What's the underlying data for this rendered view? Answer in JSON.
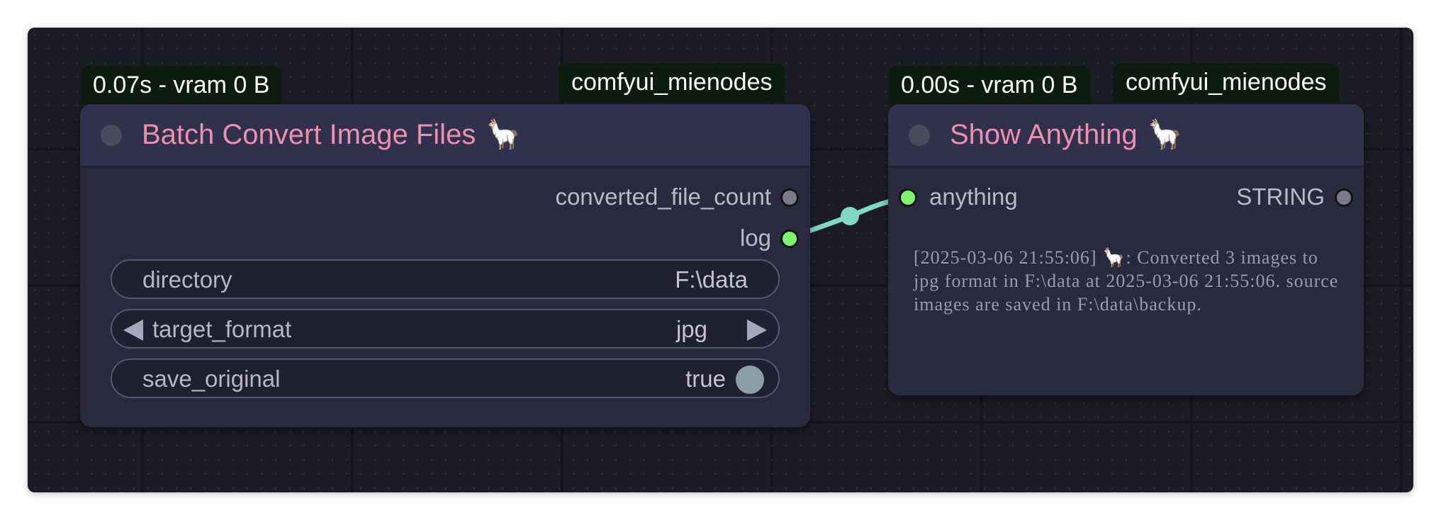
{
  "nodes": {
    "batch_convert": {
      "timing_badge": "0.07s - vram 0 B",
      "source_badge": "comfyui_mienodes",
      "title": "Batch Convert Image Files",
      "title_emoji": "🦙",
      "outputs": {
        "converted_file_count": "converted_file_count",
        "log": "log"
      },
      "widgets": {
        "directory": {
          "label": "directory",
          "value": "F:\\data"
        },
        "target_format": {
          "label": "target_format",
          "value": "jpg"
        },
        "save_original": {
          "label": "save_original",
          "value": "true"
        }
      }
    },
    "show_anything": {
      "timing_badge": "0.00s - vram 0 B",
      "source_badge": "comfyui_mienodes",
      "title": "Show Anything",
      "title_emoji": "🦙",
      "inputs": {
        "anything": "anything"
      },
      "outputs": {
        "string": "STRING"
      },
      "display_text": "[2025-03-06 21:55:06] 🦙: Converted 3 images to jpg format in F:\\data at 2025-03-06 21:55:06. source images are saved in F:\\data\\backup."
    }
  },
  "colors": {
    "title": "#ee8fad",
    "link": "#7fd8c8",
    "active_slot": "#7df56b",
    "badge_bg": "#0c1c0f",
    "canvas_bg": "#1c1c25"
  },
  "icons": {
    "title_icon": "llama-emoji",
    "collapse": "collapse-dot-icon"
  }
}
